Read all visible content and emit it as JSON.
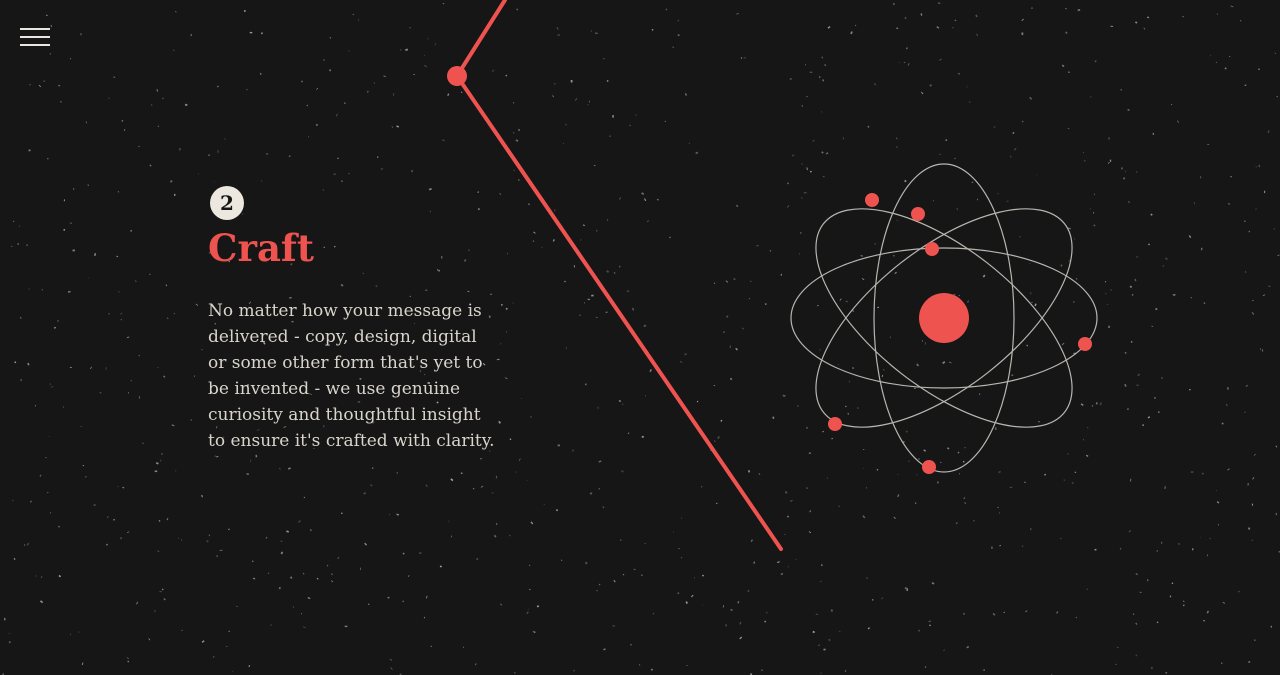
{
  "menu": {
    "icon": "hamburger-menu-icon"
  },
  "section": {
    "step_number": "2",
    "title": "Craft",
    "body": "No matter how your message is delivered - copy, design, digital or some other form that's yet to be invented - we use genuine curiosity and thoughtful insight to ensure it's crafted with clarity."
  },
  "illustration": {
    "icon": "atom-icon"
  },
  "colors": {
    "background": "#161616",
    "accent": "#ef5350",
    "text": "#d9d5cd",
    "badge": "#ece8df"
  }
}
